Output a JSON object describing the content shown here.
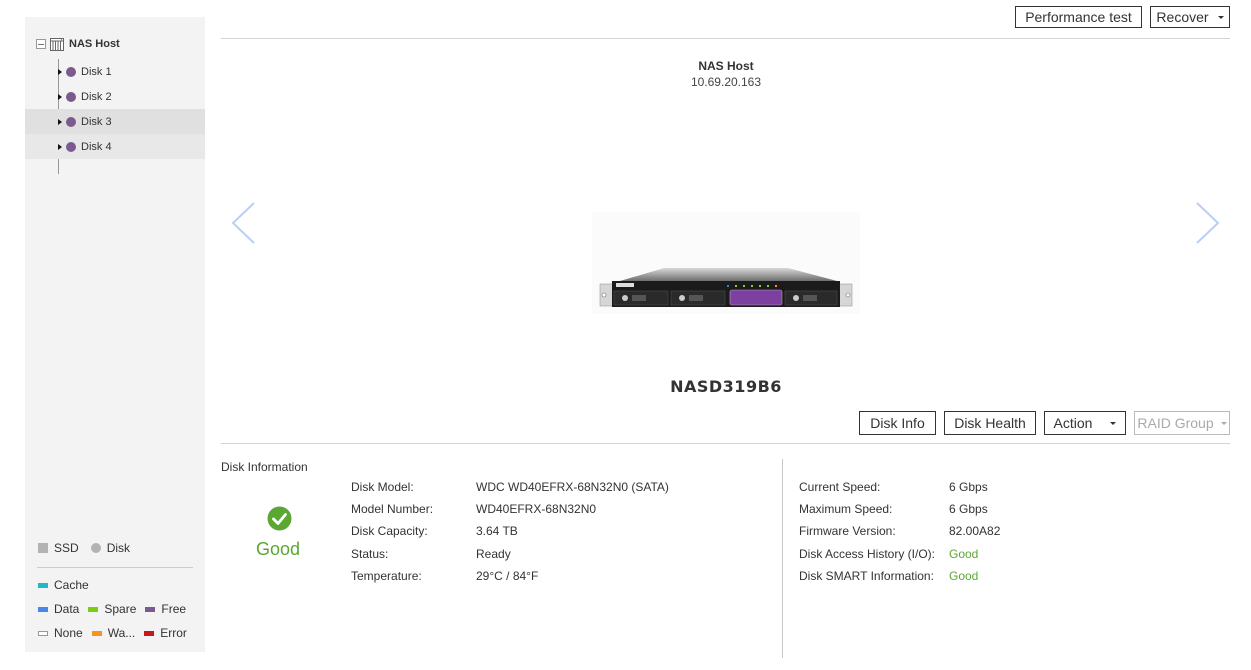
{
  "sidebar": {
    "root": {
      "label": "NAS Host",
      "icon": "nas-rack-icon",
      "expanded": true
    },
    "disks": [
      {
        "label": "Disk 1",
        "color": "#7b5a8f",
        "state": "normal"
      },
      {
        "label": "Disk 2",
        "color": "#7b5a8f",
        "state": "normal"
      },
      {
        "label": "Disk 3",
        "color": "#7b5a8f",
        "state": "selected"
      },
      {
        "label": "Disk 4",
        "color": "#7b5a8f",
        "state": "hover"
      }
    ],
    "legend": {
      "types": [
        {
          "label": "SSD",
          "shape": "square"
        },
        {
          "label": "Disk",
          "shape": "circle"
        }
      ],
      "roles": [
        {
          "label": "Cache",
          "color": "#21b9c9"
        },
        {
          "label": "Data",
          "color": "#4a86e8"
        },
        {
          "label": "Spare",
          "color": "#7dcc14"
        },
        {
          "label": "Free",
          "color": "#7b5a8f"
        },
        {
          "label": "None",
          "color": "#ffffff"
        },
        {
          "label": "Wa...",
          "color": "#f7941d"
        },
        {
          "label": "Error",
          "color": "#c8161d"
        }
      ]
    }
  },
  "toolbar": {
    "performance_test": "Performance test",
    "recover": "Recover"
  },
  "host": {
    "name": "NAS Host",
    "ip": "10.69.20.163",
    "model": "NASD319B6"
  },
  "actions": {
    "disk_info": "Disk Info",
    "disk_health": "Disk Health",
    "action": "Action",
    "raid_group": "RAID Group"
  },
  "disk_information": {
    "title": "Disk Information",
    "health": "Good",
    "health_color": "#5aa832",
    "left": [
      {
        "label": "Disk Model:",
        "value": "WDC WD40EFRX-68N32N0 (SATA)"
      },
      {
        "label": "Model Number:",
        "value": "WD40EFRX-68N32N0"
      },
      {
        "label": "Disk Capacity:",
        "value": "3.64 TB"
      },
      {
        "label": "Status:",
        "value": "Ready"
      },
      {
        "label": "Temperature:",
        "value": "29°C / 84°F"
      }
    ],
    "right": [
      {
        "label": "Current Speed:",
        "value": "6 Gbps"
      },
      {
        "label": "Maximum Speed:",
        "value": "6 Gbps"
      },
      {
        "label": "Firmware Version:",
        "value": "82.00A82"
      },
      {
        "label": "Disk Access History (I/O):",
        "value": "Good",
        "status": "good"
      },
      {
        "label": "Disk SMART Information:",
        "value": "Good",
        "status": "good"
      }
    ]
  }
}
